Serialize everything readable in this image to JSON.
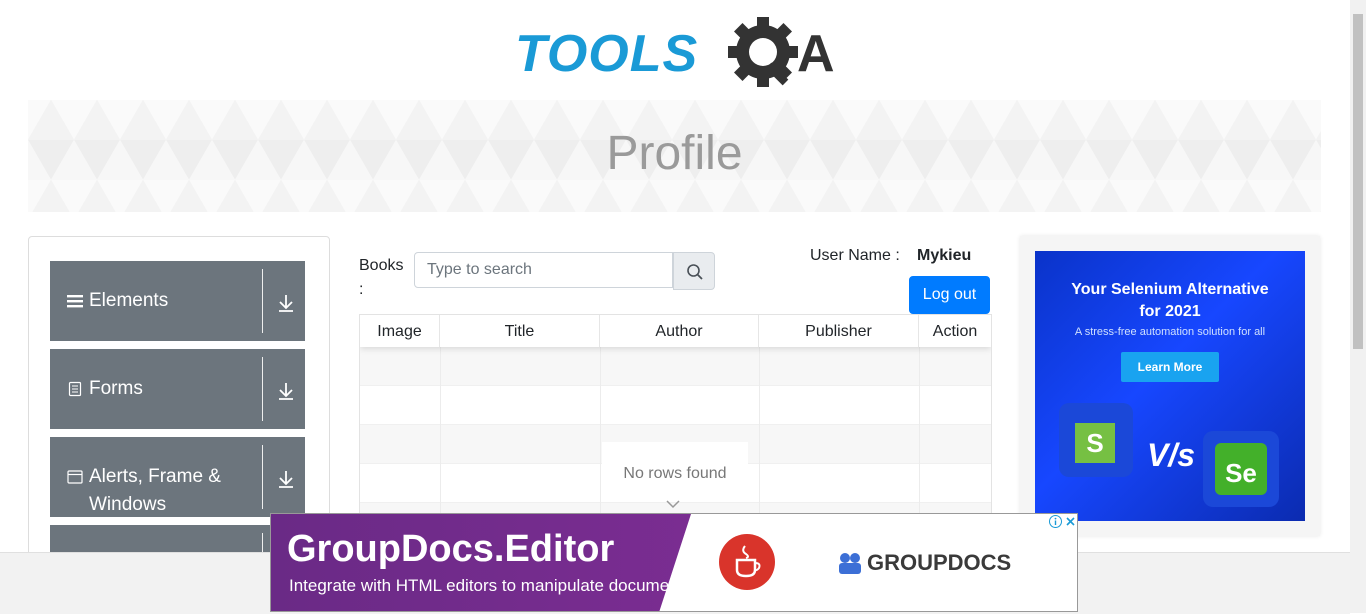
{
  "logo": {
    "tools": "TOOLS",
    "a": "A"
  },
  "banner": {
    "title": "Profile"
  },
  "sidebar": {
    "groups": [
      {
        "label": "Elements",
        "icon": "hamburger-icon"
      },
      {
        "label": "Forms",
        "icon": "document-icon"
      },
      {
        "label": "Alerts, Frame & Windows",
        "icon": "window-icon"
      }
    ]
  },
  "books": {
    "label": "Books :",
    "search_placeholder": "Type to search"
  },
  "user": {
    "label": "User Name :",
    "value": "Mykieu"
  },
  "logout_label": "Log out",
  "table": {
    "columns": [
      "Image",
      "Title",
      "Author",
      "Publisher",
      "Action"
    ],
    "empty_text": "No rows found"
  },
  "side_ad": {
    "title_line1": "Your Selenium Alternative",
    "title_line2": "for 2021",
    "subtitle": "A stress-free automation solution for all",
    "button": "Learn More",
    "vs": "V/s",
    "left_mark": "S",
    "right_mark": "Se"
  },
  "bottom_ad": {
    "title": "GroupDocs.Editor",
    "subtitle": "Integrate with HTML editors to manipulate documents",
    "brand": "GROUPDOCS"
  },
  "colors": {
    "accent": "#007bff",
    "sidebar": "#6c757d",
    "logo_blue": "#1a9ad6"
  }
}
